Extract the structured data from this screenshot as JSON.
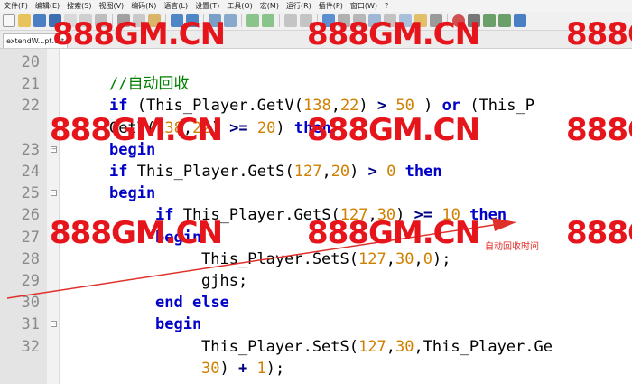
{
  "menu": [
    "文件(F)",
    "编辑(E)",
    "搜索(S)",
    "视图(V)",
    "编码(N)",
    "语言(L)",
    "设置(T)",
    "工具(O)",
    "宏(M)",
    "运行(R)",
    "插件(P)",
    "窗口(W)",
    "?"
  ],
  "tab": {
    "label": "extendW...pt.txt"
  },
  "watermark": "888GM.CN",
  "code": [
    {
      "n": "20",
      "fold": false,
      "indent": 0,
      "tokens": []
    },
    {
      "n": "21",
      "fold": false,
      "indent": 0,
      "tokens": [
        {
          "t": "//自动回收",
          "c": "cmt"
        }
      ]
    },
    {
      "n": "22",
      "fold": false,
      "indent": 0,
      "tokens": [
        {
          "t": "if",
          "c": "kw"
        },
        {
          "t": " (",
          "c": "id"
        },
        {
          "t": "This_Player.GetV(",
          "c": "id"
        },
        {
          "t": "138",
          "c": "num"
        },
        {
          "t": ",",
          "c": "id"
        },
        {
          "t": "22",
          "c": "num"
        },
        {
          "t": ") ",
          "c": "id"
        },
        {
          "t": ">",
          "c": "op"
        },
        {
          "t": " ",
          "c": "id"
        },
        {
          "t": "50",
          "c": "num"
        },
        {
          "t": " ) ",
          "c": "id"
        },
        {
          "t": "or",
          "c": "kw"
        },
        {
          "t": " (This_P",
          "c": "id"
        }
      ]
    },
    {
      "n": "",
      "fold": false,
      "indent": 0,
      "tokens": [
        {
          "t": "GetV(",
          "c": "id"
        },
        {
          "t": "138",
          "c": "num"
        },
        {
          "t": ",",
          "c": "id"
        },
        {
          "t": "22",
          "c": "num"
        },
        {
          "t": ") ",
          "c": "id"
        },
        {
          "t": ">=",
          "c": "op"
        },
        {
          "t": " ",
          "c": "id"
        },
        {
          "t": "20",
          "c": "num"
        },
        {
          "t": ") ",
          "c": "id"
        },
        {
          "t": "then",
          "c": "kw"
        }
      ]
    },
    {
      "n": "23",
      "fold": true,
      "indent": 0,
      "tokens": [
        {
          "t": "begin",
          "c": "kw"
        }
      ]
    },
    {
      "n": "24",
      "fold": false,
      "indent": 0,
      "tokens": [
        {
          "t": "if",
          "c": "kw"
        },
        {
          "t": " This_Player.GetS(",
          "c": "id"
        },
        {
          "t": "127",
          "c": "num"
        },
        {
          "t": ",",
          "c": "id"
        },
        {
          "t": "20",
          "c": "num"
        },
        {
          "t": ") ",
          "c": "id"
        },
        {
          "t": ">",
          "c": "op"
        },
        {
          "t": " ",
          "c": "id"
        },
        {
          "t": "0",
          "c": "num"
        },
        {
          "t": " ",
          "c": "id"
        },
        {
          "t": "then",
          "c": "kw"
        }
      ]
    },
    {
      "n": "25",
      "fold": true,
      "indent": 0,
      "tokens": [
        {
          "t": "begin",
          "c": "kw"
        }
      ]
    },
    {
      "n": "26",
      "fold": false,
      "indent": 1,
      "tokens": [
        {
          "t": "if",
          "c": "kw"
        },
        {
          "t": " This_Player.GetS(",
          "c": "id"
        },
        {
          "t": "127",
          "c": "num"
        },
        {
          "t": ",",
          "c": "id"
        },
        {
          "t": "30",
          "c": "num"
        },
        {
          "t": ") ",
          "c": "id"
        },
        {
          "t": ">=",
          "c": "op"
        },
        {
          "t": " ",
          "c": "id"
        },
        {
          "t": "10",
          "c": "num"
        },
        {
          "t": " ",
          "c": "id"
        },
        {
          "t": "then",
          "c": "kw"
        }
      ]
    },
    {
      "n": "27",
      "fold": true,
      "indent": 1,
      "tokens": [
        {
          "t": "begin",
          "c": "kw"
        }
      ]
    },
    {
      "n": "28",
      "fold": false,
      "indent": 2,
      "tokens": [
        {
          "t": "This_Player.SetS(",
          "c": "id"
        },
        {
          "t": "127",
          "c": "num"
        },
        {
          "t": ",",
          "c": "id"
        },
        {
          "t": "30",
          "c": "num"
        },
        {
          "t": ",",
          "c": "id"
        },
        {
          "t": "0",
          "c": "num"
        },
        {
          "t": ");",
          "c": "id"
        }
      ]
    },
    {
      "n": "29",
      "fold": false,
      "indent": 2,
      "tokens": [
        {
          "t": "gjhs;",
          "c": "id"
        }
      ]
    },
    {
      "n": "30",
      "fold": false,
      "indent": 1,
      "tokens": [
        {
          "t": "end",
          "c": "kw"
        },
        {
          "t": " ",
          "c": "id"
        },
        {
          "t": "else",
          "c": "kw"
        }
      ]
    },
    {
      "n": "31",
      "fold": true,
      "indent": 1,
      "tokens": [
        {
          "t": "begin",
          "c": "kw"
        }
      ]
    },
    {
      "n": "32",
      "fold": false,
      "indent": 2,
      "tokens": [
        {
          "t": "This_Player.SetS(",
          "c": "id"
        },
        {
          "t": "127",
          "c": "num"
        },
        {
          "t": ",",
          "c": "id"
        },
        {
          "t": "30",
          "c": "num"
        },
        {
          "t": ",This_Player.Ge",
          "c": "id"
        }
      ]
    },
    {
      "n": "",
      "fold": false,
      "indent": 2,
      "tokens": [
        {
          "t": "30",
          "c": "num"
        },
        {
          "t": ") ",
          "c": "id"
        },
        {
          "t": "+",
          "c": "op"
        },
        {
          "t": " ",
          "c": "id"
        },
        {
          "t": "1",
          "c": "num"
        },
        {
          "t": ");",
          "c": "id"
        }
      ]
    }
  ],
  "annotation": {
    "label": "自动回收时间",
    "color": "#e0302a"
  },
  "colors": {
    "watermark": "#e6141b",
    "keyword": "#0000c8",
    "number": "#d08000",
    "comment": "#008000"
  }
}
